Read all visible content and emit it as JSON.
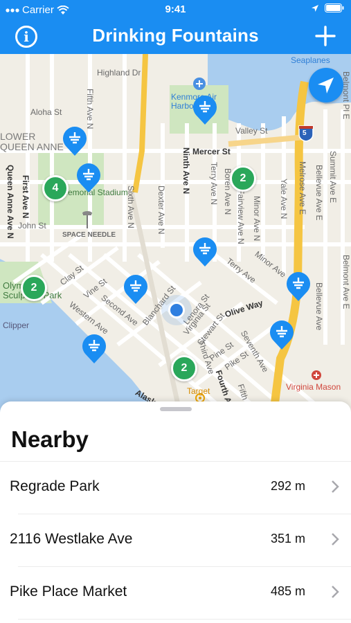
{
  "status_bar": {
    "carrier": "Carrier",
    "time": "9:41"
  },
  "nav": {
    "title": "Drinking Fountains",
    "info_icon": "info-icon",
    "add_icon": "plus-icon"
  },
  "map": {
    "labels": {
      "highland_dr": "Highland Dr",
      "aloha_st": "Aloha St",
      "lower_queen_anne": "LOWER\nQUEEN ANNE",
      "mercer_st": "Mercer St",
      "valley_st": "Valley St",
      "seaplanes": "Seaplanes",
      "kenmore_air_harbor": "Kenmore Air\nHarbor",
      "memorial_stadium": "Memorial Stadium",
      "john_st": "John St",
      "space_needle": "SPACE NEEDLE",
      "queen_anne_ave_n": "Queen Anne Ave N",
      "first_ave_n": "First Ave N",
      "fifth_ave_n": "Fifth Ave N",
      "sixth_ave_n": "Sixth Ave N",
      "dexter_ave_n": "Dexter Ave N",
      "ninth_ave_n": "Ninth Ave N",
      "terry_ave_n": "Terry Ave N",
      "boren_ave_n": "Boren Ave N",
      "fairview_ave_n": "Fairview Ave N",
      "minor_ave_n": "Minor Ave N",
      "yale_ave_n": "Yale Ave N",
      "melrose_ave_e": "Melrose Ave E",
      "bellevue_ave_e": "Bellevue Ave E",
      "summit_ave_e": "Summit Ave E",
      "belmont_pl_e": "Belmont Pl E",
      "belmont_ave_e": "Belmont Ave E",
      "bellevue_ave": "Bellevue Ave",
      "minor_ave": "Minor Ave",
      "terry_ave": "Terry Ave",
      "olive_way": "Olive Way",
      "clay_st": "Clay St",
      "vine_st": "Vine St",
      "western_ave": "Western Ave",
      "second_ave": "Second Ave",
      "blanchard_st": "Blanchard St",
      "lenora_st": "Lenora St",
      "virginia_st": "Virginia St",
      "stewart_st": "Stewart St",
      "pine_st": "Pine St",
      "pike_st": "Pike St",
      "seventh_ave": "Seventh Ave",
      "third_ave": "Third Ave",
      "fourth_ave": "Fourth Ave",
      "fifth_ave": "Fifth",
      "olympic_sculpture_park": "Olympic\nSculpture Park",
      "clipper": "Clipper",
      "target": "Target",
      "virginia_mason": "Virginia Mason",
      "alaskan_way": "Alaskan",
      "highway_5": "5"
    },
    "clusters": [
      "4",
      "2",
      "2",
      "2"
    ],
    "pin_icon": "fountain-pin-icon",
    "locate_icon": "location-arrow-icon"
  },
  "nearby": {
    "title": "Nearby",
    "items": [
      {
        "name": "Regrade Park",
        "distance": "292 m"
      },
      {
        "name": "2116 Westlake Ave",
        "distance": "351 m"
      },
      {
        "name": "Pike Place Market",
        "distance": "485 m"
      }
    ]
  },
  "colors": {
    "accent": "#1a8df2",
    "cluster": "#2aa75a",
    "park": "#cfe6c0",
    "water": "#a9cdef",
    "highway": "#f5c542"
  }
}
